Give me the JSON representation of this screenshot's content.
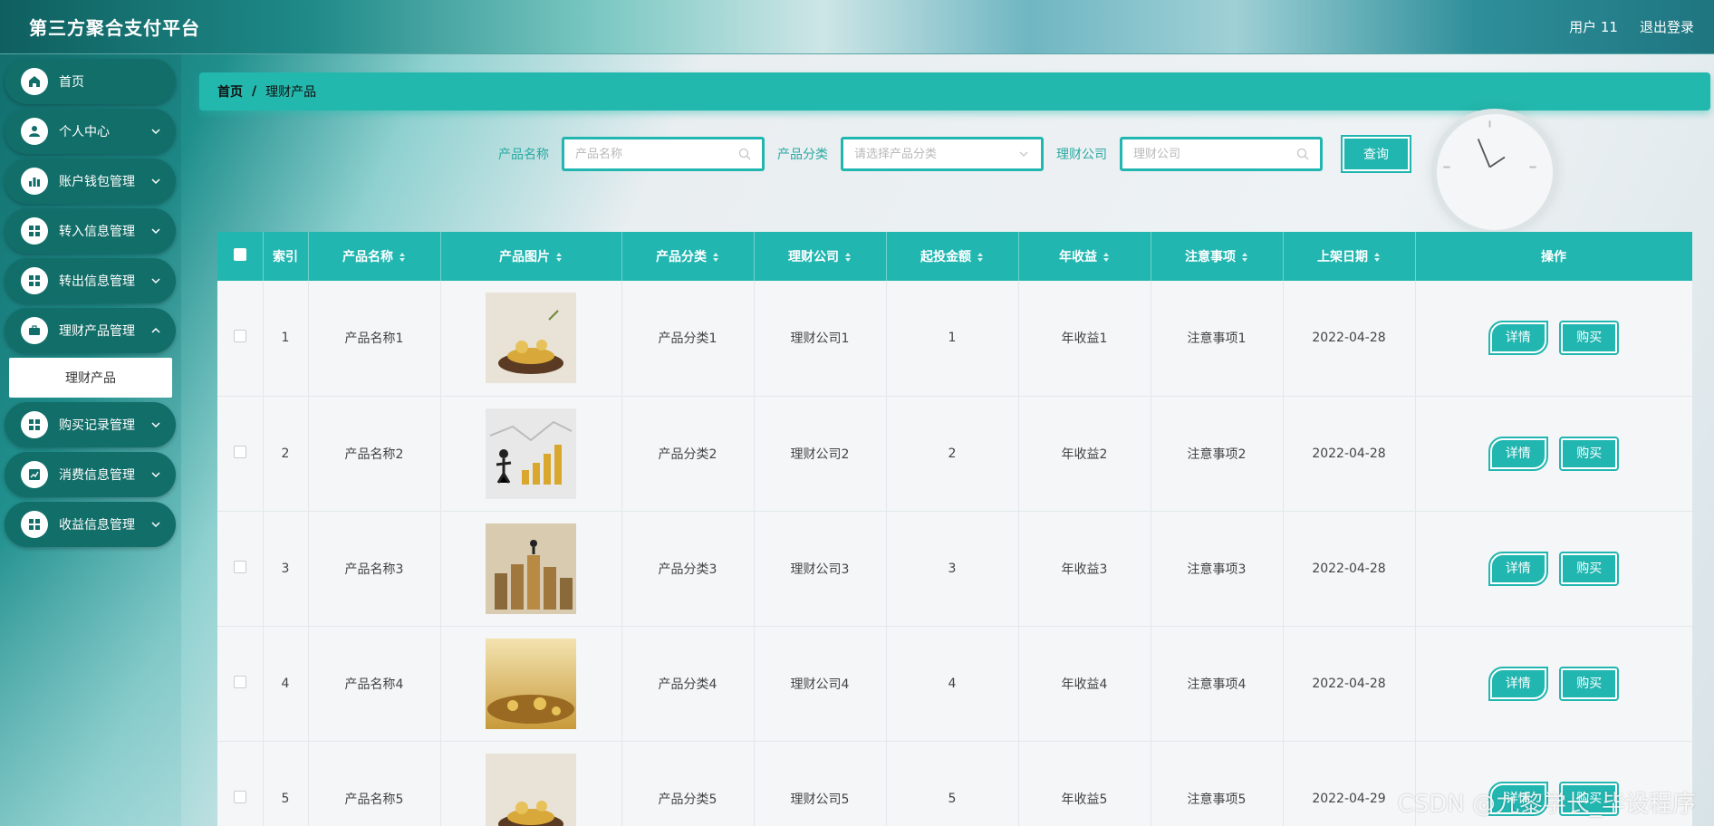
{
  "header": {
    "title": "第三方聚合支付平台",
    "user": "用户 11",
    "logout": "退出登录"
  },
  "sidebar": {
    "items": [
      {
        "label": "首页",
        "icon": "home-icon",
        "expandable": false
      },
      {
        "label": "个人中心",
        "icon": "user-icon",
        "expandable": true
      },
      {
        "label": "账户钱包管理",
        "icon": "bar-chart-icon",
        "expandable": true
      },
      {
        "label": "转入信息管理",
        "icon": "grid-icon",
        "expandable": true
      },
      {
        "label": "转出信息管理",
        "icon": "grid-icon",
        "expandable": true
      },
      {
        "label": "理财产品管理",
        "icon": "briefcase-icon",
        "expandable": true
      },
      {
        "label": "购买记录管理",
        "icon": "grid-icon",
        "expandable": true
      },
      {
        "label": "消费信息管理",
        "icon": "trend-icon",
        "expandable": true
      },
      {
        "label": "收益信息管理",
        "icon": "grid-icon",
        "expandable": true
      }
    ],
    "submenu": {
      "label": "理财产品"
    }
  },
  "breadcrumb": {
    "home": "首页",
    "separator": "/",
    "current": "理财产品"
  },
  "search": {
    "name_label": "产品名称",
    "name_placeholder": "产品名称",
    "category_label": "产品分类",
    "category_placeholder": "请选择产品分类",
    "company_label": "理财公司",
    "company_placeholder": "理财公司",
    "query_button": "查询"
  },
  "table": {
    "headers": [
      "索引",
      "产品名称",
      "产品图片",
      "产品分类",
      "理财公司",
      "起投金额",
      "年收益",
      "注意事项",
      "上架日期",
      "操作"
    ],
    "detail_label": "详情",
    "buy_label": "购买",
    "rows": [
      {
        "index": "1",
        "name": "产品名称1",
        "category": "产品分类1",
        "company": "理财公司1",
        "amount": "1",
        "yield": "年收益1",
        "notes": "注意事项1",
        "date": "2022-04-28"
      },
      {
        "index": "2",
        "name": "产品名称2",
        "category": "产品分类2",
        "company": "理财公司2",
        "amount": "2",
        "yield": "年收益2",
        "notes": "注意事项2",
        "date": "2022-04-28"
      },
      {
        "index": "3",
        "name": "产品名称3",
        "category": "产品分类3",
        "company": "理财公司3",
        "amount": "3",
        "yield": "年收益3",
        "notes": "注意事项3",
        "date": "2022-04-28"
      },
      {
        "index": "4",
        "name": "产品名称4",
        "category": "产品分类4",
        "company": "理财公司4",
        "amount": "4",
        "yield": "年收益4",
        "notes": "注意事项4",
        "date": "2022-04-28"
      },
      {
        "index": "5",
        "name": "产品名称5",
        "category": "产品分类5",
        "company": "理财公司5",
        "amount": "5",
        "yield": "年收益5",
        "notes": "注意事项5",
        "date": "2022-04-29"
      }
    ]
  },
  "watermark": "CSDN @九黎学长_毕设程序",
  "colors": {
    "accent": "#22b6b1",
    "menu": "#126e69"
  }
}
